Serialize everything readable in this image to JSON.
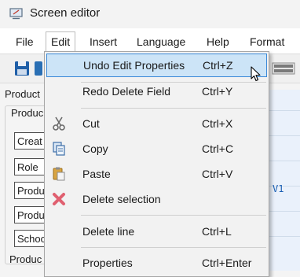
{
  "window": {
    "title": "Screen editor"
  },
  "menubar": {
    "items": [
      {
        "label": "File"
      },
      {
        "label": "Edit"
      },
      {
        "label": "Insert"
      },
      {
        "label": "Language"
      },
      {
        "label": "Help"
      },
      {
        "label": "Format"
      }
    ]
  },
  "form": {
    "tab_label": "Product",
    "group_label": "Produc",
    "fields": [
      "Creat",
      "Role",
      "Produ",
      "Produ",
      "Schoo"
    ],
    "right_value": "V1",
    "bottom_label": "Produc"
  },
  "edit_menu": {
    "items": [
      {
        "label": "Undo Edit Properties",
        "shortcut": "Ctrl+Z",
        "icon": "",
        "highlighted": true
      },
      {
        "label": "Redo Delete Field",
        "shortcut": "Ctrl+Y",
        "icon": ""
      },
      {
        "label": "Cut",
        "shortcut": "Ctrl+X",
        "icon": "scissors-icon"
      },
      {
        "label": "Copy",
        "shortcut": "Ctrl+C",
        "icon": "copy-icon"
      },
      {
        "label": "Paste",
        "shortcut": "Ctrl+V",
        "icon": "paste-icon"
      },
      {
        "label": "Delete selection",
        "shortcut": "",
        "icon": "delete-x-icon"
      },
      {
        "label": "Delete line",
        "shortcut": "Ctrl+L",
        "icon": ""
      },
      {
        "label": "Properties",
        "shortcut": "Ctrl+Enter",
        "icon": ""
      }
    ]
  },
  "colors": {
    "highlight_bg": "#cce4f7",
    "highlight_border": "#3b8ad8",
    "delete_icon": "#e06070"
  }
}
